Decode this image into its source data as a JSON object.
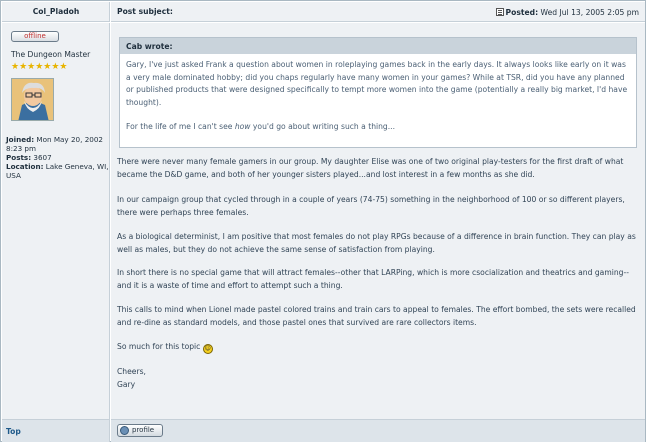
{
  "author": {
    "name": "Col_Pladoh",
    "status": "offline",
    "rank": "The Dungeon Master",
    "stars": "★★★★★★★",
    "avatar_icon": "wizard-avatar",
    "joined_label": "Joined:",
    "joined_value": "Mon May 20, 2002 8:23 pm",
    "posts_label": "Posts:",
    "posts_value": "3607",
    "location_label": "Location:",
    "location_value": "Lake Geneva, WI, USA"
  },
  "header": {
    "subject_label": "Post subject:",
    "posted_label": "Posted:",
    "posted_value": "Wed Jul 13, 2005 2:05 pm"
  },
  "quote": {
    "header": "Cab wrote:",
    "para1": "Gary, I've just asked Frank a question about women in roleplaying games back in the early days. It always looks like early on it was a very male dominated hobby; did you chaps regularly have many women in your games? While at TSR, did you have any planned or published products that were designed specifically to tempt more women into the game (potentially a really big market, I'd have thought).",
    "para2_pre": "For the life of me I can't see ",
    "para2_em": "how",
    "para2_post": " you'd go about writing such a thing..."
  },
  "body": {
    "p1": "There were never many female gamers in our group. My daughter Elise was one of two original play-testers for the first draft of what became the D&D game, and both of her younger sisters played...and lost interest in a few months as she did.",
    "p2": "In our campaign group that cycled through in a couple of years (74-75) something in the neighborhood of 100 or so different players, there were perhaps three females.",
    "p3": "As a biological determinist, I am positive that most females do not play RPGs because of a difference in brain function. They can play as well as males, but they do not achieve the same sense of satisfaction from playing.",
    "p4": "In short there is no special game that will attract females--other that LARPing, which is more csocialization and theatrics and gaming--and it is a waste of time and effort to attempt such a thing.",
    "p5": "This calls to mind when Lionel made pastel colored trains and train cars to appeal to females. The effort bombed, the sets were recalled and re-dine as standard models, and those pastel ones that survived are rare collectors items.",
    "p6": "So much for this topic",
    "p7a": "Cheers,",
    "p7b": "Gary"
  },
  "footer": {
    "top_label": "Top",
    "profile_label": "profile"
  }
}
